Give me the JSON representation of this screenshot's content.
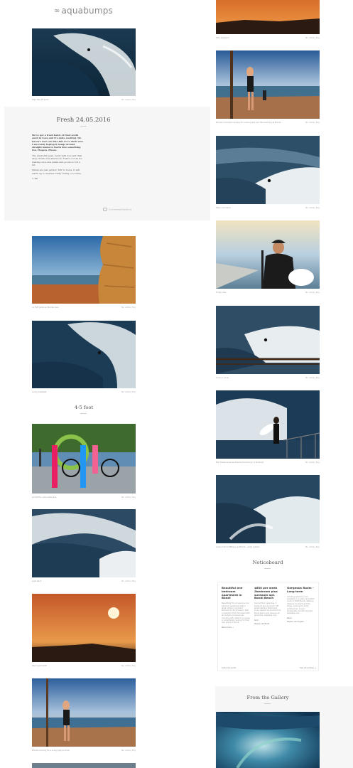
{
  "site": {
    "logo_text": "aquabumps"
  },
  "left_posts": [
    {
      "caption": "High tide off point",
      "meta": "No. Aloha | Buy"
    },
    {
      "caption": "no fluff golds up Bronte cave",
      "meta": "No. Aloha | Buy"
    },
    {
      "caption": "Lucky breakfast",
      "meta": "No. Aloha | Buy"
    },
    {
      "caption": "wonderful colour bike stop",
      "meta": "No. Aloha | Buy"
    },
    {
      "caption": "push back",
      "meta": "No. Aloha | Buy"
    },
    {
      "caption": "Warm gold stuff",
      "meta": "No. Aloha | Buy"
    },
    {
      "caption": "Bronte morning for a sunny jelly and hat",
      "meta": "No. Aloha | Buy"
    }
  ],
  "right_posts": [
    {
      "caption": "Silky weekend",
      "meta": "No. Aloha | Buy"
    },
    {
      "caption": "Bronte moments lounging for a sunny jelly and the sunrising at Bronte",
      "meta": "No. Aloha | Buy"
    },
    {
      "caption": "Hello cool shore",
      "meta": "No. Aloha | Buy"
    },
    {
      "caption": "Friday vibe",
      "meta": "No. Aloha | Buy"
    },
    {
      "caption": "Lines in a row",
      "meta": "No. Aloha | Buy"
    },
    {
      "caption": "Bob Fishbone shows Bronte free the top of the bowl",
      "meta": "No. Aloha | Buy"
    },
    {
      "caption": "Lucky to find offshore up Bronte - just a mellow",
      "meta": "No. Aloha | Buy"
    }
  ],
  "fresh": {
    "title": "Fresh 24.05.2016",
    "paragraphs": [
      "We've got a fresh batch of tired south swell in town and it's quite swelling. We haven't seen one like this for a while now. I am really hoping it hangs around straight banks in South into something fun. Fingers. Please.",
      "The swell will peak, back right now and then drop off into the afternoon. That's cool as it's making out a few plains and goods to roll a bit.",
      "Winds are just perfect, NW to boots. It will warm up to degrees today. Sunny, of course.",
      "> lan"
    ],
    "comment_label": "Comments/Questions"
  },
  "section_45": {
    "title": "4-5 foot"
  },
  "noticeboard": {
    "title": "Noticeboard",
    "items": [
      {
        "heading": "Beautiful one bedroom apartment in Bondi",
        "text": "Beautifully fit out spacious one bedroom apartment with a large outdoor courtyard. Moments to Bondi beach. Pets considered. Fully furnished with all modern conveniences including wifi. Ideal for a couple or small family looking for their own space in Bondi.",
        "link": "Read more →",
        "footer": "Submit events"
      },
      {
        "heading": "$650 per week 2bedroom plus sunroom apt. Bondi Beach",
        "text": "Second floor, spacious, 2 bedroom plus sunroom. Off street parking. Bright and sunny aspect. One block from Bondi beach and close to all amenities. Available now.",
        "link": "Sold",
        "link2": "Please call Brett"
      },
      {
        "heading": "Gorgeous Room - Long term",
        "text": "Amazing spacious room available in a newly renovated home in North Bondi. Walking distance to beach and the shops. Looking for a tidy professional. Lovely housemate. All bills included. Available now.",
        "link": "Read",
        "link2": "Please call Angela",
        "footer": "See all entries →"
      }
    ]
  },
  "gallery": {
    "title": "From the Gallery"
  }
}
